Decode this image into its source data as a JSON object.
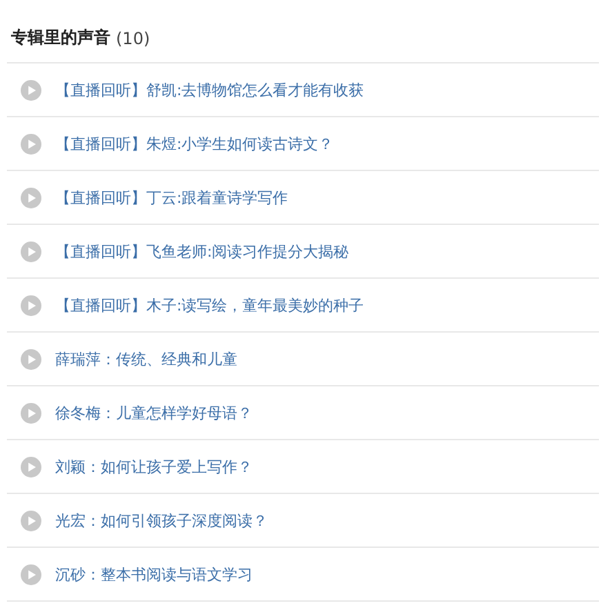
{
  "header": {
    "title": "专辑里的声音",
    "count": "(10)"
  },
  "tracks": [
    {
      "title": "【直播回听】舒凯:去博物馆怎么看才能有收获"
    },
    {
      "title": "【直播回听】朱煜:小学生如何读古诗文？"
    },
    {
      "title": "【直播回听】丁云:跟着童诗学写作"
    },
    {
      "title": "【直播回听】飞鱼老师:阅读习作提分大揭秘"
    },
    {
      "title": "【直播回听】木子:读写绘，童年最美妙的种子"
    },
    {
      "title": "薛瑞萍：传统、经典和儿童"
    },
    {
      "title": "徐冬梅：儿童怎样学好母语？"
    },
    {
      "title": "刘颖：如何让孩子爱上写作？"
    },
    {
      "title": "光宏：如何引领孩子深度阅读？"
    },
    {
      "title": "沉砂：整本书阅读与语文学习"
    }
  ]
}
